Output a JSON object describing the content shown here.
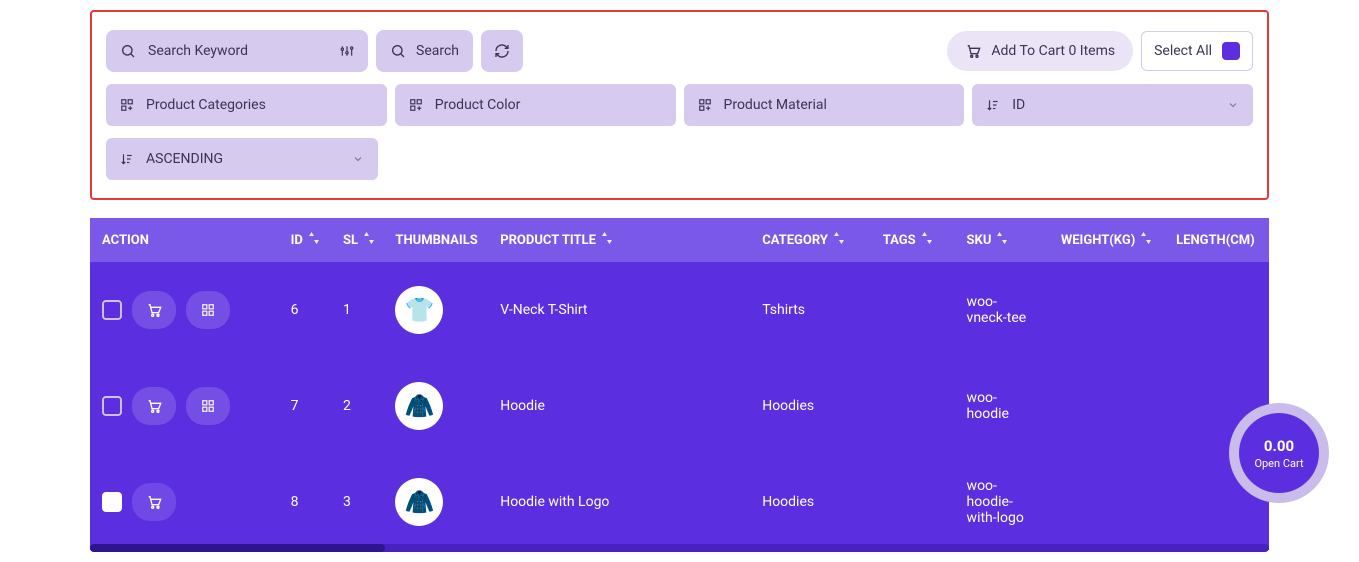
{
  "search": {
    "placeholder": "Search Keyword",
    "button": "Search"
  },
  "cart_button": "Add To Cart 0 Items",
  "select_all": "Select All",
  "filters": {
    "categories": "Product Categories",
    "color": "Product Color",
    "material": "Product Material",
    "sort_by": "ID",
    "sort_dir": "ASCENDING"
  },
  "columns": {
    "action": "ACTION",
    "id": "ID",
    "sl": "SL",
    "thumbnails": "THUMBNAILS",
    "title": "PRODUCT TITLE",
    "category": "CATEGORY",
    "tags": "TAGS",
    "sku": "SKU",
    "weight": "WEIGHT(KG)",
    "length": "LENGTH(CM)"
  },
  "rows": [
    {
      "id": "6",
      "sl": "1",
      "title": "V-Neck T-Shirt",
      "category": "Tshirts",
      "tags": "",
      "sku": "woo-vneck-tee",
      "weight": "",
      "length": "",
      "thumb": "👕",
      "thumb_name": "tshirt-thumbnail"
    },
    {
      "id": "7",
      "sl": "2",
      "title": "Hoodie",
      "category": "Hoodies",
      "tags": "",
      "sku": "woo-hoodie",
      "weight": "",
      "length": "",
      "thumb": "🧥",
      "thumb_name": "hoodie-thumbnail"
    },
    {
      "id": "8",
      "sl": "3",
      "title": "Hoodie with Logo",
      "category": "Hoodies",
      "tags": "",
      "sku": "woo-hoodie-with-logo",
      "weight": "",
      "length": "",
      "thumb": "🧥",
      "thumb_name": "hoodie-logo-thumbnail"
    }
  ],
  "float_cart": {
    "amount": "0.00",
    "label": "Open Cart"
  }
}
